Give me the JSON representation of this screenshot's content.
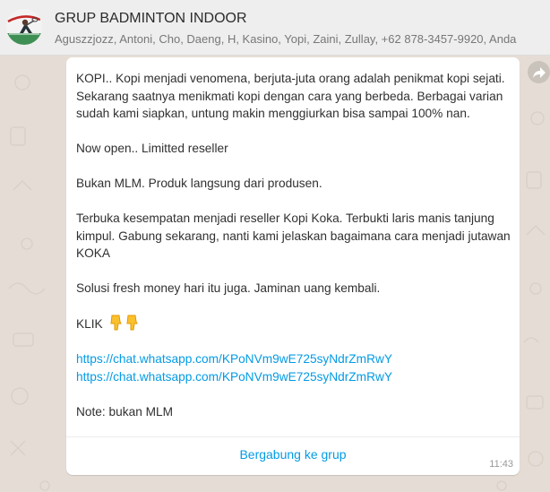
{
  "header": {
    "group_name": "GRUP BADMINTON INDOOR",
    "participants": "Aguszzjozz, Antoni, Cho, Daeng, H, Kasino, Yopi, Zaini, Zullay, +62 878-3457-9920, Anda"
  },
  "message": {
    "paragraphs": [
      "KOPI.. Kopi menjadi venomena, berjuta-juta orang adalah penikmat kopi sejati. Sekarang saatnya menikmati kopi dengan cara yang berbeda. Berbagai varian sudah kami siapkan, untung makin menggiurkan bisa sampai 100% nan.",
      "Now open.. Limitted reseller",
      "Bukan MLM. Produk langsung dari produsen.",
      "Terbuka kesempatan menjadi reseller Kopi Koka. Terbukti laris manis tanjung kimpul. Gabung sekarang, nanti kami jelaskan bagaimana cara menjadi jutawan KOKA",
      "Solusi fresh money hari itu juga. Jaminan uang kembali."
    ],
    "klik_label": "KLIK",
    "links": [
      "https://chat.whatsapp.com/KPoNVm9wE725syNdrZmRwY",
      "https://chat.whatsapp.com/KPoNVm9wE725syNdrZmRwY"
    ],
    "note": "Note: bukan MLM",
    "join_button": "Bergabung ke grup",
    "timestamp": "11:43"
  },
  "icons": {
    "avatar": "group-avatar-badminton",
    "klik_emoji": "pointing-down-hand-icon",
    "forward": "forward-arrow-icon"
  },
  "colors": {
    "link": "#039be5",
    "header_bg": "#eeeeee",
    "chat_bg": "#e5ddd5",
    "bubble_bg": "#ffffff"
  }
}
